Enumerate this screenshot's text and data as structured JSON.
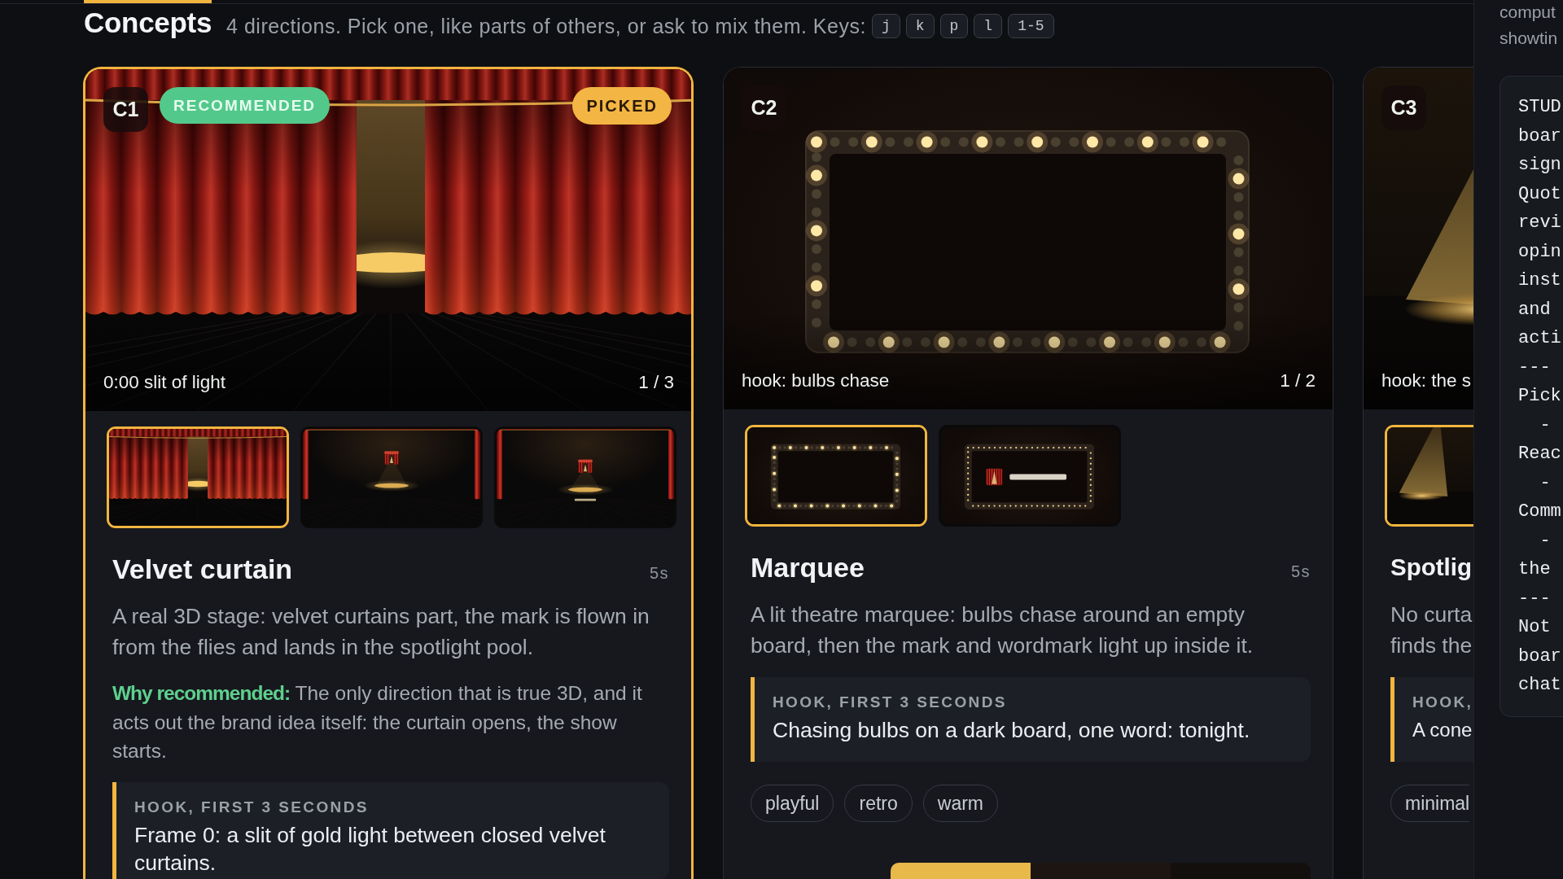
{
  "header": {
    "title": "Concepts",
    "subtitle": "4 directions. Pick one, like parts of others, or ask to mix them. Keys:",
    "keys": [
      "j",
      "k",
      "p",
      "l",
      "1-5"
    ]
  },
  "concepts": [
    {
      "code": "C1",
      "picked": true,
      "badges": [
        {
          "kind": "recommended",
          "label": "RECOMMENDED"
        },
        {
          "kind": "picked",
          "label": "PICKED"
        }
      ],
      "caption": "0:00 slit of light",
      "counter": "1 / 3",
      "frames": [
        {
          "kind": "curtain-slit",
          "selected": true
        },
        {
          "kind": "stage-mark",
          "selected": false
        },
        {
          "kind": "stage-wordmark",
          "selected": false
        }
      ],
      "title": "Velvet curtain",
      "duration": "5s",
      "description": "A real 3D stage: velvet curtains part, the mark is flown in from the flies and lands in the spotlight pool.",
      "rationale": "**Why recommended:** The only direction that is true 3D, and it acts out the brand idea itself: the curtain opens, the show starts.",
      "hook": {
        "label": "HOOK, FIRST 3 SECONDS",
        "text": "Frame 0: a slit of gold light between closed velvet curtains."
      }
    },
    {
      "code": "C2",
      "picked": false,
      "caption": "hook: bulbs chase",
      "counter": "1 / 2",
      "frames": [
        {
          "kind": "marquee-empty",
          "selected": true
        },
        {
          "kind": "marquee-wordmark",
          "selected": false
        }
      ],
      "title": "Marquee",
      "duration": "5s",
      "description": "A lit theatre marquee: bulbs chase around an empty board, then the mark and wordmark light up inside it.",
      "hook": {
        "label": "HOOK, FIRST 3 SECONDS",
        "text": "Chasing bulbs on a dark board, one word: tonight."
      },
      "tags": [
        "playful",
        "retro",
        "warm"
      ],
      "palette": [
        {
          "color": "#e8b84a"
        },
        {
          "color": "#1d1511"
        },
        {
          "color": "#130f0d"
        }
      ]
    },
    {
      "code": "C3",
      "picked": false,
      "caption": "hook: the s",
      "frames": [
        {
          "kind": "spotlight",
          "selected": true
        }
      ],
      "title": "Spotlig",
      "description": "No curta\nfinds the",
      "hook": {
        "label": "HOOK,",
        "text": "A cone"
      },
      "tags": [
        "minimal"
      ]
    }
  ],
  "side_panel": {
    "text": "comput\nshowtin",
    "code": "STUD\nboar\nsign\nQuot\nrevi\nopin\ninst\nand\nacti\n---\nPick\n  -\nReac\n  -\nComm\n  -\nthe\n---\nNot\nboar\nchat"
  }
}
